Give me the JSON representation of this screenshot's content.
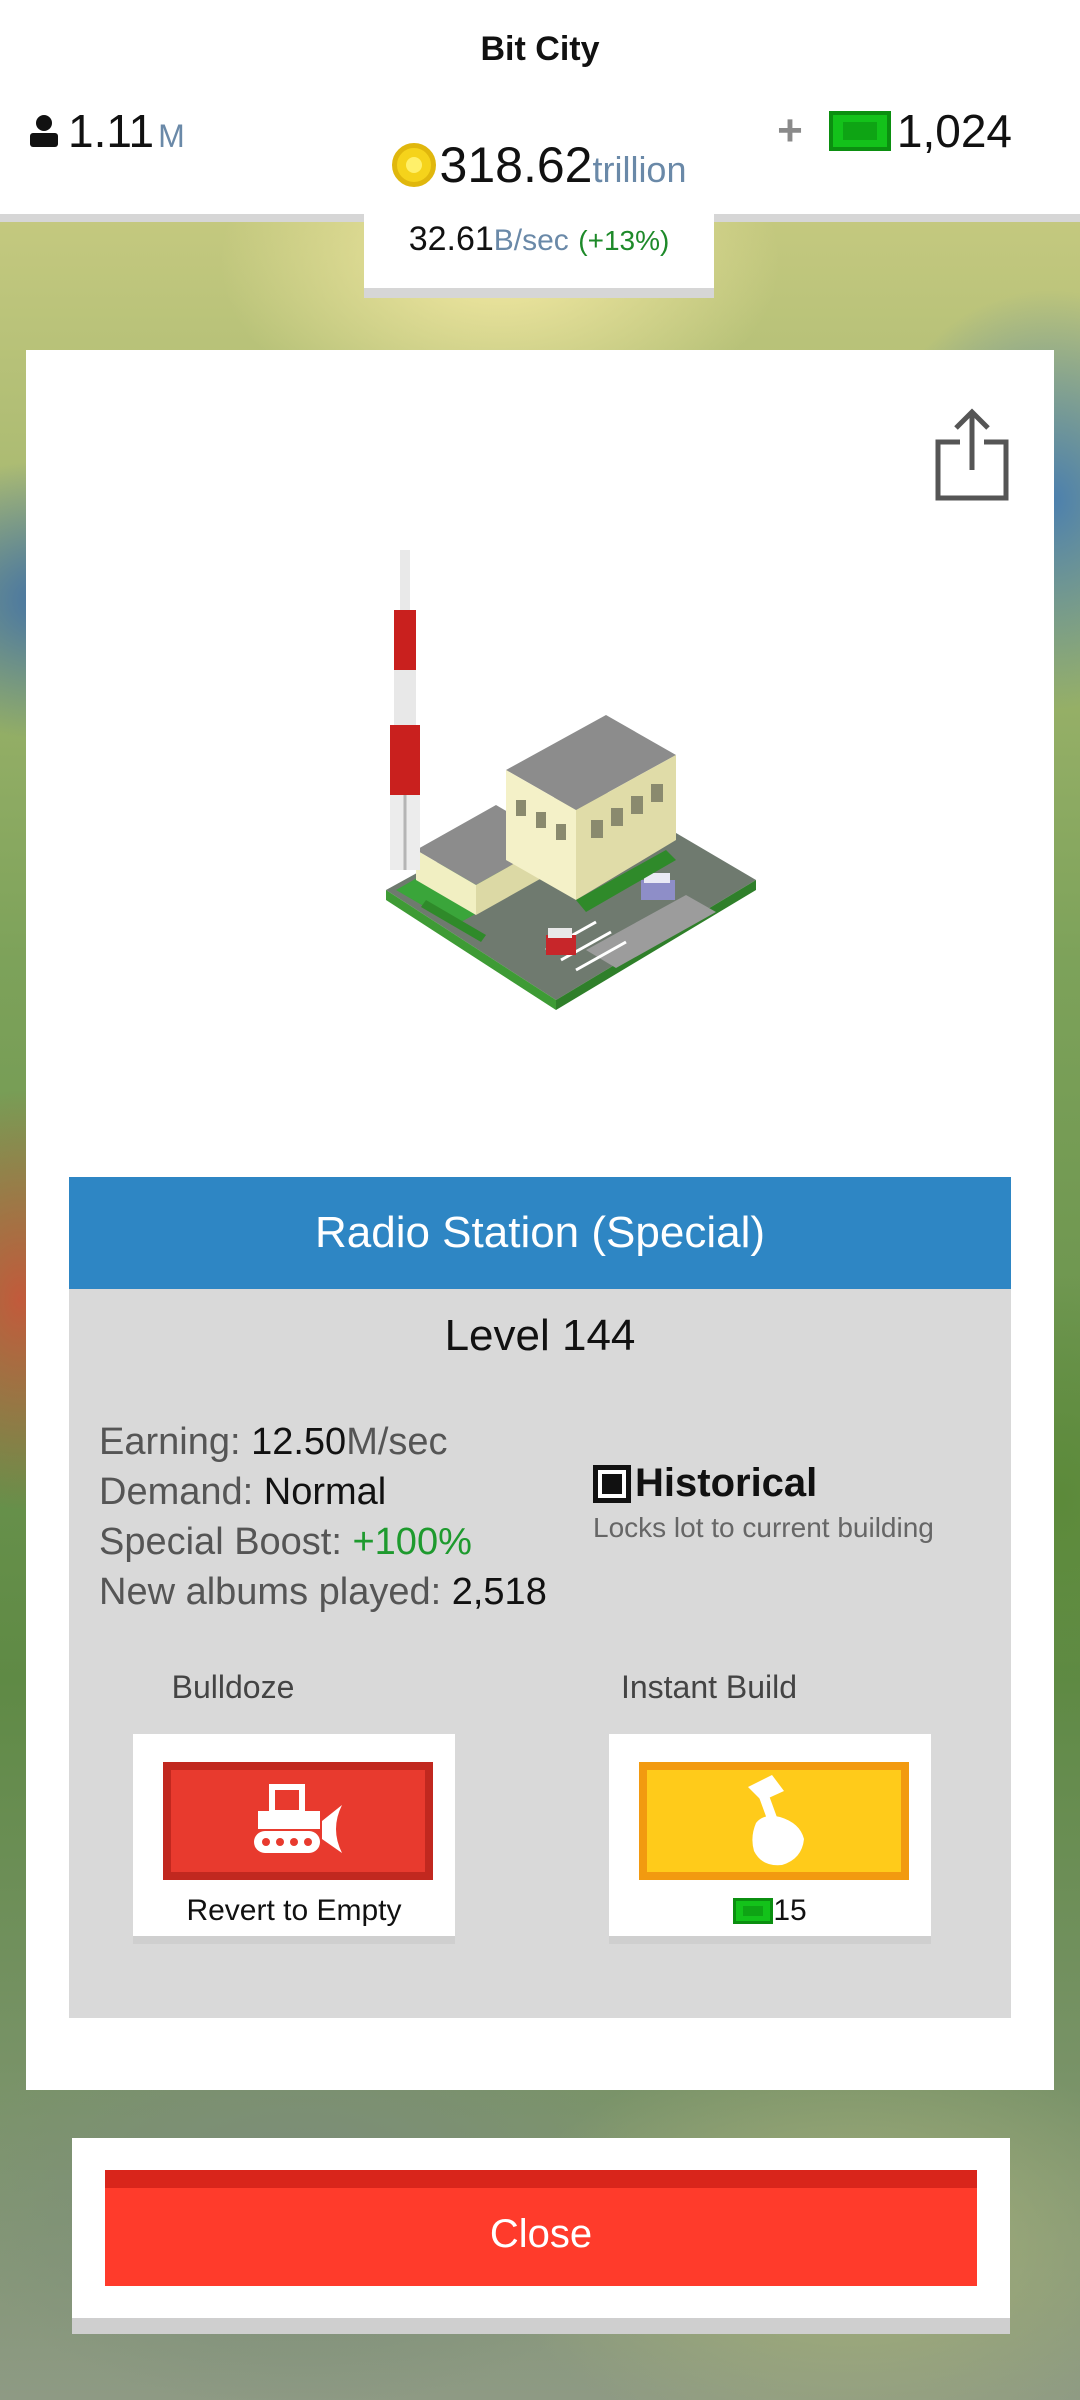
{
  "header": {
    "title": "Bit City",
    "population": {
      "value": "1.11",
      "unit": "M"
    },
    "coins": {
      "value": "318.62",
      "unit": "trillion"
    },
    "rate": {
      "value": "32.61",
      "unit": "B/sec",
      "boost": "(+13%)"
    },
    "cash": {
      "plus": "+",
      "value": "1,024"
    }
  },
  "building": {
    "title": "Radio Station (Special)",
    "level": "Level 144",
    "stats": [
      {
        "label": "Earning: ",
        "value": "12.50",
        "unit": "M/sec"
      },
      {
        "label": "Demand: ",
        "value": "Normal"
      },
      {
        "label": "Special Boost: ",
        "value": "+100%"
      },
      {
        "label": "New albums played: ",
        "value": "2,518"
      }
    ],
    "historical": {
      "title": "Historical",
      "subtitle": "Locks lot to current building",
      "checked": true
    }
  },
  "actions": {
    "bulldoze": {
      "label": "Bulldoze",
      "caption": "Revert to Empty"
    },
    "instant_build": {
      "label": "Instant Build",
      "cost": "15"
    }
  },
  "close_label": "Close",
  "icons": [
    "person-icon",
    "coin-icon",
    "cash-icon",
    "share-icon",
    "bulldozer-icon",
    "hammer-hand-icon",
    "checkbox-icon"
  ],
  "colors": {
    "header_blue": "#2e86c4",
    "bulldoze_red": "#e83a2e",
    "instant_yellow": "#ffcb1a",
    "close_red": "#ff3b2b",
    "cash_green": "#13c21a",
    "boost_green": "#1e9a2e"
  }
}
